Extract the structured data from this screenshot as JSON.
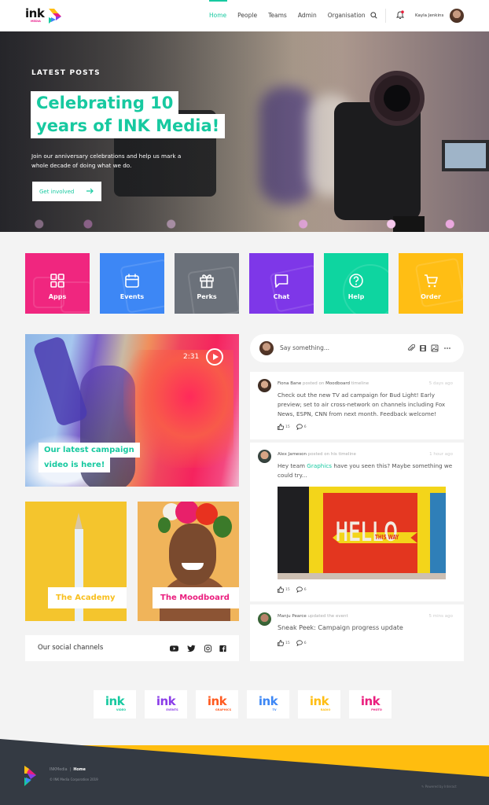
{
  "brand": {
    "wordmark": "ink",
    "sub": "MEDIA"
  },
  "nav": {
    "items": [
      {
        "label": "Home",
        "active": true
      },
      {
        "label": "People"
      },
      {
        "label": "Teams"
      },
      {
        "label": "Admin"
      },
      {
        "label": "Organisation"
      }
    ],
    "user_name": "Kayla Jenkins",
    "icons": [
      "search-icon",
      "bell-icon"
    ],
    "notification_dot": true
  },
  "hero": {
    "kicker": "LATEST POSTS",
    "title_lines": [
      "Celebrating 10",
      "years of INK Media!"
    ],
    "description": "Join our anniversary celebrations and help us mark a whole decade of doing what we do.",
    "cta_label": "Get involved",
    "cta_icon": "arrow-right-icon"
  },
  "tiles": [
    {
      "label": "Apps",
      "icon": "grid-icon",
      "color": "#f0267f"
    },
    {
      "label": "Events",
      "icon": "calendar-icon",
      "color": "#3d87f5"
    },
    {
      "label": "Perks",
      "icon": "gift-icon",
      "color": "#6b717a"
    },
    {
      "label": "Chat",
      "icon": "chat-bubble-icon",
      "color": "#7e37e8"
    },
    {
      "label": "Help",
      "icon": "question-circle-icon",
      "color": "#0ed5a0"
    },
    {
      "label": "Order",
      "icon": "cart-icon",
      "color": "#ffbe14"
    }
  ],
  "video": {
    "duration": "2:31",
    "caption_lines": [
      "Our latest campaign",
      "video is here!"
    ]
  },
  "cards": {
    "academy": {
      "label": "The Academy",
      "color": "#f8bf1e"
    },
    "moodboard": {
      "label": "The Moodboard",
      "color": "#ea1e7e"
    }
  },
  "social": {
    "title": "Our social channels",
    "icons": [
      "youtube-icon",
      "twitter-icon",
      "instagram-icon",
      "facebook-icon"
    ]
  },
  "composer": {
    "placeholder": "Say something...",
    "icons": [
      "paperclip-icon",
      "film-icon",
      "image-icon",
      "more-icon"
    ]
  },
  "feed": [
    {
      "author": "Fiona Bane",
      "action": "posted on",
      "target": "Moodboard",
      "suffix": "timeline",
      "time": "5 days ago",
      "body": "Check out the new TV ad campaign for Bud Light! Early preview; set to air cross-network on channels including Fox News, ESPN, CNN from next month. Feedback welcome!",
      "likes": "15",
      "comments": "6"
    },
    {
      "author": "Alex Jameson",
      "action": "posted on his timeline",
      "time": "1 hour ago",
      "body_pre": "Hey team ",
      "body_highlight": "Graphics",
      "body_post": " have you seen this? Maybe something we could try...",
      "image_text": "HELLO",
      "image_banner": "THIS WAY",
      "likes": "15",
      "comments": "6"
    },
    {
      "author": "Manju Pearce",
      "action": "updated the event",
      "time": "5 mins ago",
      "body": "Sneak Peek: Campaign progress update",
      "likes": "15",
      "comments": "6"
    }
  ],
  "brands": [
    {
      "word": "ink",
      "sub": "VIDEO",
      "color": "#17c9a0"
    },
    {
      "word": "ink",
      "sub": "EVENTS",
      "color": "#8a3ce8"
    },
    {
      "word": "ink",
      "sub": "GRAPHICS",
      "color": "#ff5a1f"
    },
    {
      "word": "ink",
      "sub": "TV",
      "color": "#3d87f5"
    },
    {
      "word": "ink",
      "sub": "RADIO",
      "color": "#ffbe14"
    },
    {
      "word": "ink",
      "sub": "PHOTO",
      "color": "#ea1e7e"
    }
  ],
  "footer": {
    "site": "INKMedia",
    "separator": "|",
    "current": "Home",
    "copyright": "INK Media Corporation 2019",
    "powered_by": "Powered by Interact"
  },
  "colors": {
    "accent": "#17c9a0",
    "footer_bg": "#343a43",
    "footer_band": "#ffbd0f"
  }
}
